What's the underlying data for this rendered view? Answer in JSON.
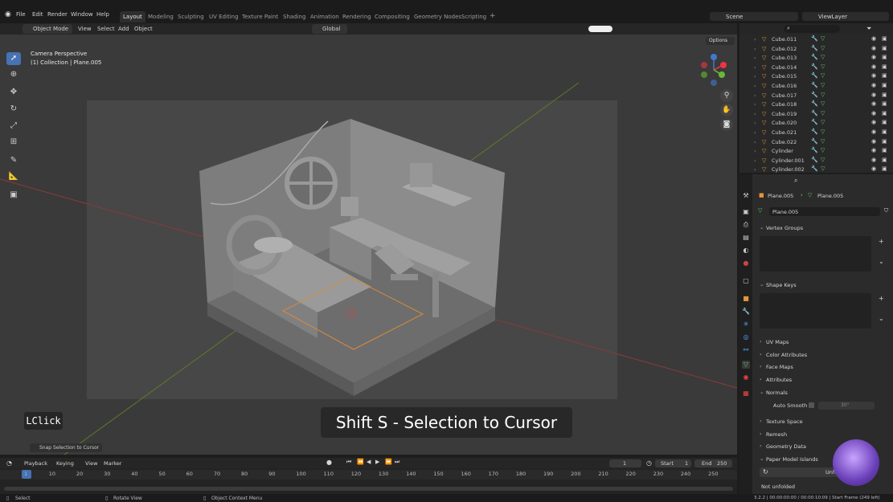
{
  "topbar": {
    "menus": [
      "File",
      "Edit",
      "Render",
      "Window",
      "Help"
    ],
    "workspaces": [
      "Layout",
      "Modeling",
      "Sculpting",
      "UV Editing",
      "Texture Paint",
      "Shading",
      "Animation",
      "Rendering",
      "Compositing",
      "Geometry Nodes",
      "Scripting"
    ],
    "active_workspace": "Layout",
    "add_tab": "+",
    "scene": "Scene",
    "view_layer": "ViewLayer"
  },
  "viewport_header": {
    "mode": "Object Mode",
    "menus": [
      "View",
      "Select",
      "Add",
      "Object"
    ],
    "orientation": "Global",
    "options": "Options"
  },
  "viewport": {
    "camera_label": "Camera Perspective",
    "collection_label": "(1) Collection | Plane.005",
    "operator_panel": "Snap Selection to Cursor"
  },
  "overlays": {
    "key": "LClick",
    "caption": "Shift S - Selection to Cursor"
  },
  "outliner": {
    "items": [
      {
        "name": "Cube.011"
      },
      {
        "name": "Cube.012"
      },
      {
        "name": "Cube.013"
      },
      {
        "name": "Cube.014"
      },
      {
        "name": "Cube.015"
      },
      {
        "name": "Cube.016"
      },
      {
        "name": "Cube.017"
      },
      {
        "name": "Cube.018"
      },
      {
        "name": "Cube.019"
      },
      {
        "name": "Cube.020"
      },
      {
        "name": "Cube.021"
      },
      {
        "name": "Cube.022"
      },
      {
        "name": "Cylinder"
      },
      {
        "name": "Cylinder.001"
      },
      {
        "name": "Cylinder.002"
      }
    ]
  },
  "properties": {
    "breadcrumb_object": "Plane.005",
    "breadcrumb_data": "Plane.005",
    "mesh_name": "Plane.005",
    "panels": {
      "vertex_groups": "Vertex Groups",
      "shape_keys": "Shape Keys",
      "uv_maps": "UV Maps",
      "color_attributes": "Color Attributes",
      "face_maps": "Face Maps",
      "attributes": "Attributes",
      "normals": "Normals",
      "auto_smooth": "Auto Smooth",
      "auto_smooth_angle": "30°",
      "texture_space": "Texture Space",
      "remesh": "Remesh",
      "geometry_data": "Geometry Data",
      "paper_model_islands": "Paper Model Islands",
      "unfold": "Unfold",
      "not_unfolded": "Not unfolded"
    }
  },
  "timeline": {
    "menus": [
      "Playback",
      "Keying",
      "View",
      "Marker"
    ],
    "current_frame": "1",
    "start_label": "Start",
    "start_value": "1",
    "end_label": "End",
    "end_value": "250",
    "ruler": [
      "1",
      "10",
      "20",
      "30",
      "40",
      "50",
      "60",
      "70",
      "80",
      "90",
      "100",
      "110",
      "120",
      "130",
      "140",
      "150",
      "160",
      "170",
      "180",
      "190",
      "200",
      "210",
      "220",
      "230",
      "240",
      "250"
    ]
  },
  "statusbar": {
    "select": "Select",
    "rotate": "Rotate View",
    "context": "Object Context Menu",
    "info": "3.2.2 | 00:00:00:00 / 00:00:10:09 | Start Frame (249 left)"
  },
  "colors": {
    "accent": "#4772b3",
    "object_icon": "#e8953a",
    "mesh_data": "#63c26f"
  }
}
